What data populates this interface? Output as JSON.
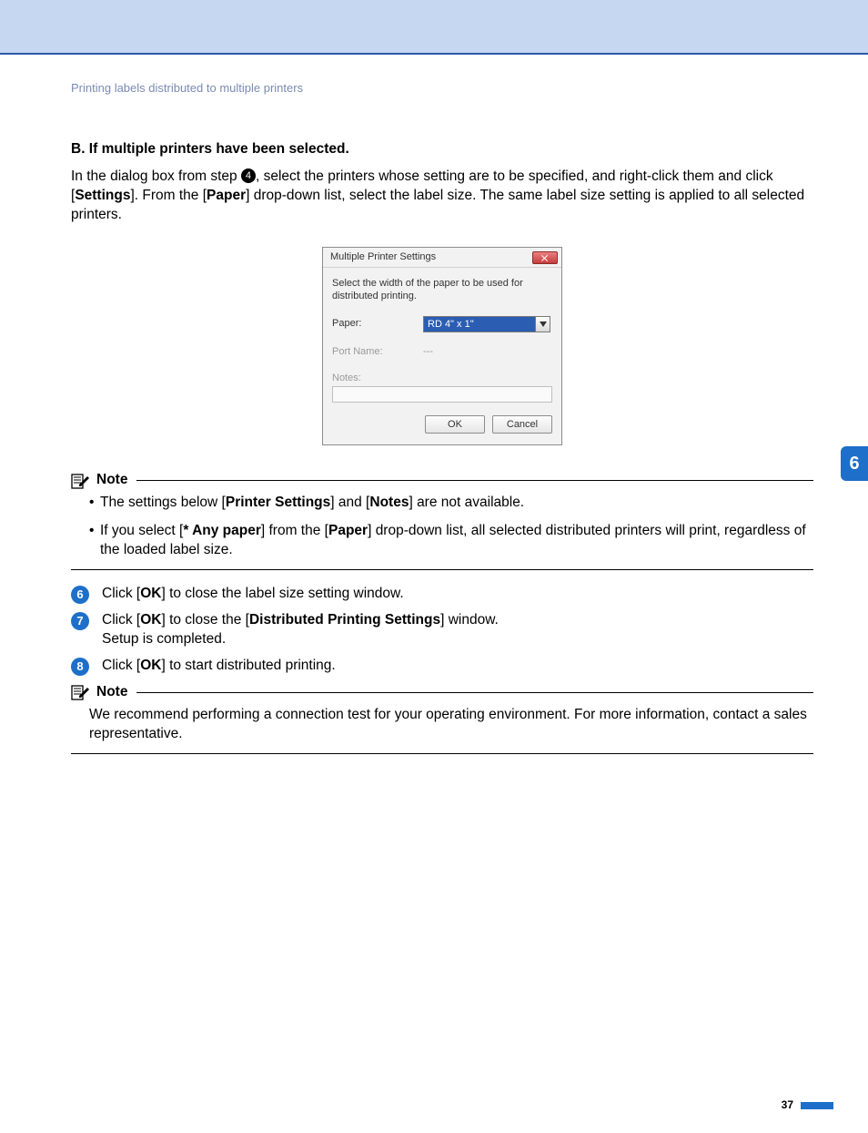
{
  "header": {
    "crumb": "Printing labels distributed to multiple printers"
  },
  "section": {
    "title": "B. If multiple printers have been selected.",
    "para_a": "In the dialog box from step ",
    "step_ref": "4",
    "para_b": ", select the printers whose setting are to be specified, and right-click them and click [",
    "settings": "Settings",
    "para_c": "]. From the [",
    "paper": "Paper",
    "para_d": "] drop-down list, select the label size. The same label size setting is applied to all selected printers."
  },
  "dialog": {
    "title": "Multiple Printer Settings",
    "instruction": "Select the width of the paper to be used for distributed printing.",
    "paper_label": "Paper:",
    "paper_value": "RD 4\" x 1\"",
    "port_label": "Port Name:",
    "port_value": "---",
    "notes_label": "Notes:",
    "ok": "OK",
    "cancel": "Cancel"
  },
  "note1": {
    "title": "Note",
    "bullet1_a": "The settings below [",
    "bullet1_b": "Printer Settings",
    "bullet1_c": "] and [",
    "bullet1_d": "Notes",
    "bullet1_e": "] are not available.",
    "bullet2_a": "If you select [",
    "bullet2_b": "* Any paper",
    "bullet2_c": "] from the [",
    "bullet2_d": "Paper",
    "bullet2_e": "] drop-down list, all selected distributed printers will print, regardless of the loaded label size."
  },
  "steps": {
    "s6_num": "6",
    "s6_a": "Click [",
    "s6_b": "OK",
    "s6_c": "] to close the label size setting window.",
    "s7_num": "7",
    "s7_a": "Click [",
    "s7_b": "OK",
    "s7_c": "] to close the [",
    "s7_d": "Distributed Printing Settings",
    "s7_e": "] window.",
    "s7_f": "Setup is completed.",
    "s8_num": "8",
    "s8_a": "Click [",
    "s8_b": "OK",
    "s8_c": "] to start distributed printing."
  },
  "note2": {
    "title": "Note",
    "text": "We recommend performing a connection test for your operating environment. For more information, contact a sales representative."
  },
  "sidebar": {
    "chapter": "6"
  },
  "footer": {
    "page": "37"
  }
}
